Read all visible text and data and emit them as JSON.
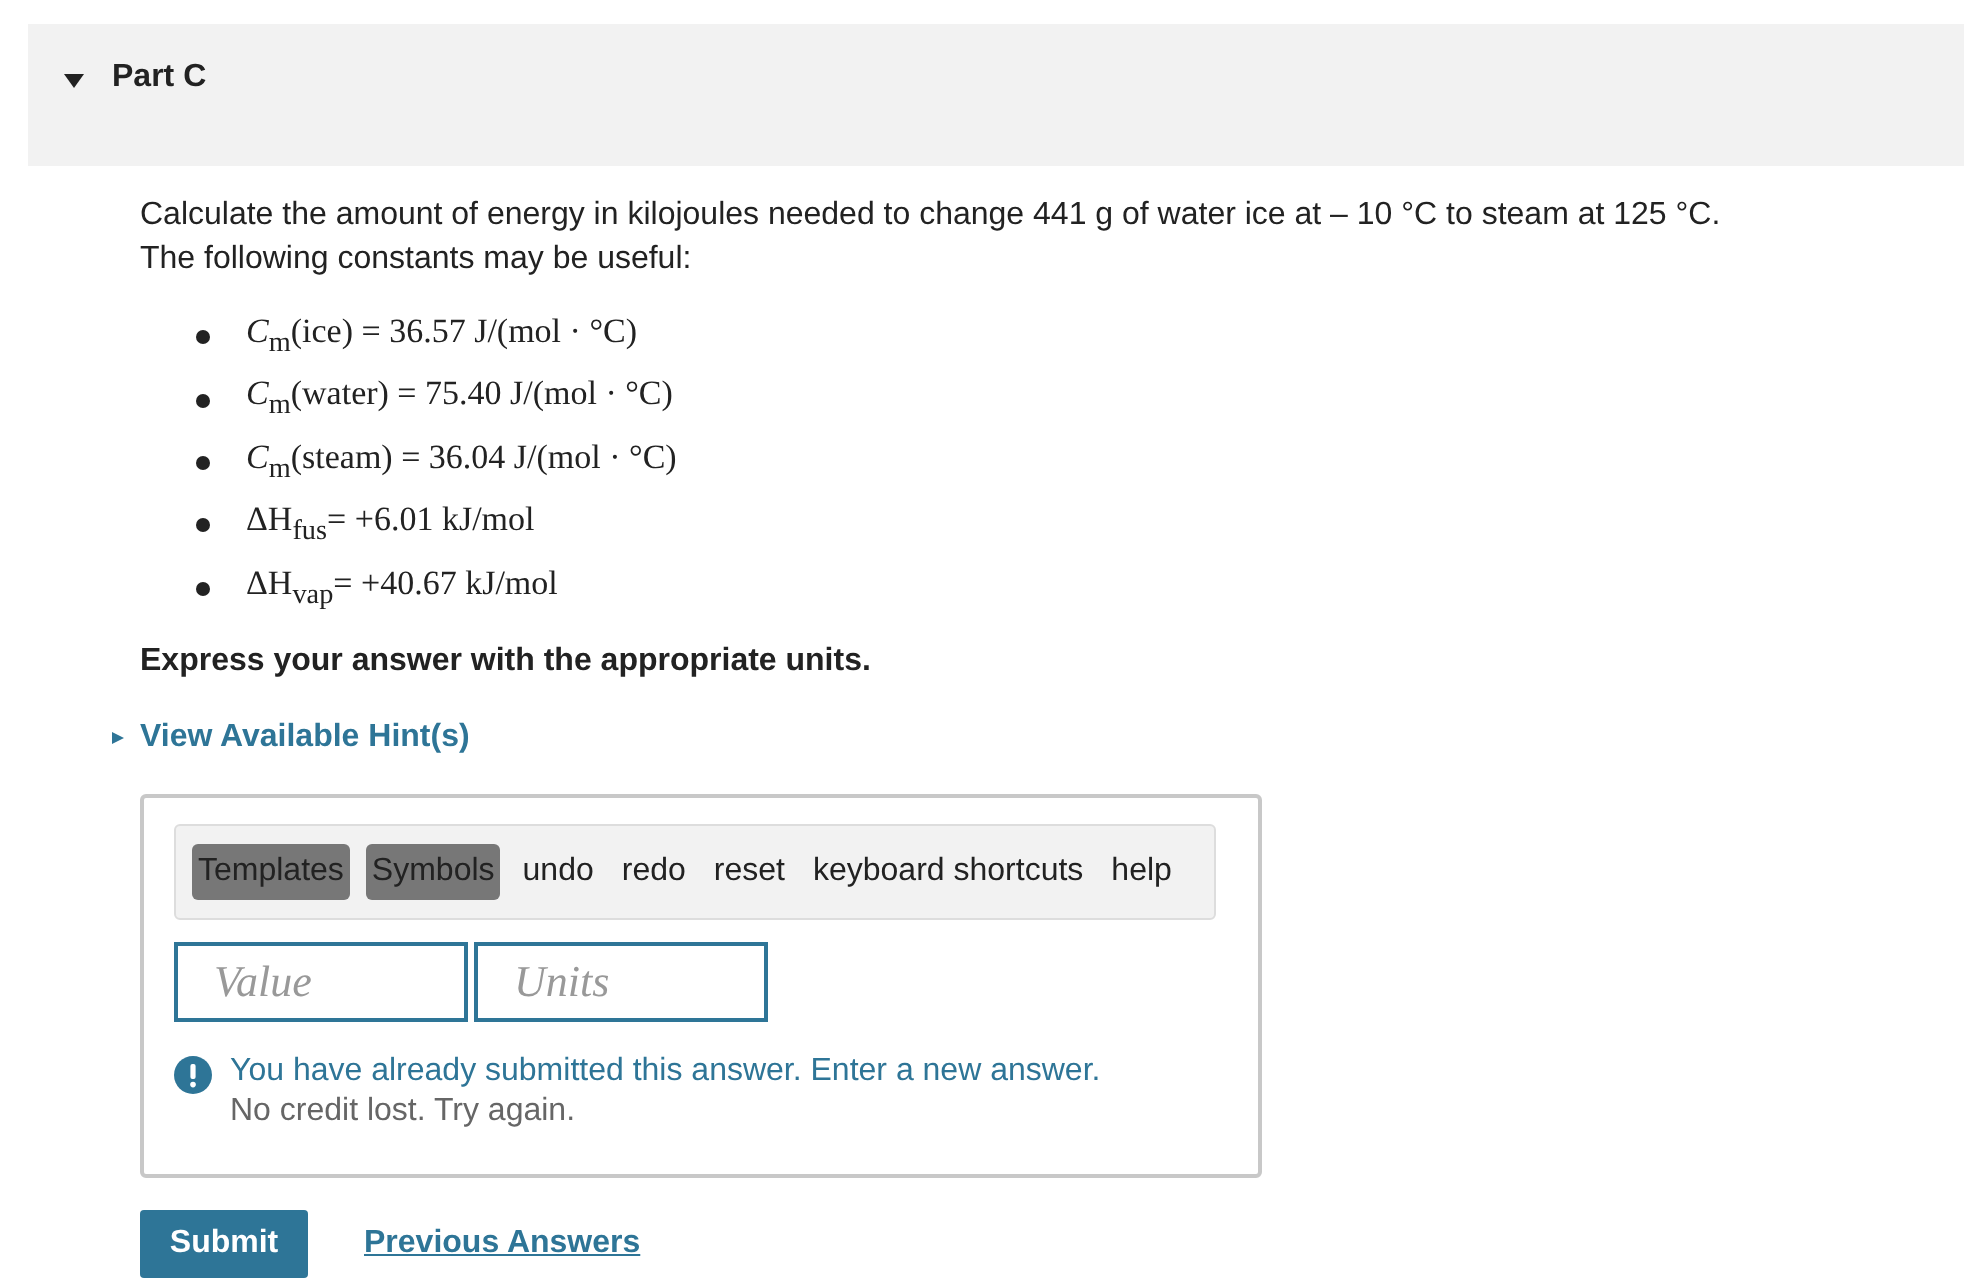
{
  "part": {
    "title": "Part C",
    "expanded": true
  },
  "question": [
    "Calculate the amount of energy in kilojoules needed to change 441 g of water ice at – 10 °C to steam at 125 °C.",
    "The following constants may be useful:"
  ],
  "constants": [
    "*C*$_{m}$(ice) = 36.57 J/(mol · °C)",
    "*C*$_{m}$(water) = 75.40 J/(mol · °C)",
    "*C*$_{m}$(steam) = 36.04 J/(mol · °C)",
    "ΔH$_{fus}$= +6.01 kJ/mol",
    "ΔH$_{vap}$= +40.67 kJ/mol"
  ],
  "instruction": "Express your answer with the appropriate units.",
  "hint": {
    "label": "View Available Hint(s)",
    "expanded": false
  },
  "toolbar": [
    {
      "label": "Templates",
      "kind": "menu"
    },
    {
      "label": "Symbols",
      "kind": "menu"
    },
    {
      "label": "undo",
      "kind": "plain"
    },
    {
      "label": "redo",
      "kind": "plain"
    },
    {
      "label": "reset",
      "kind": "plain"
    },
    {
      "label": "keyboard shortcuts",
      "kind": "plain"
    },
    {
      "label": "help",
      "kind": "plain"
    }
  ],
  "fields": [
    {
      "placeholder": "Value"
    },
    {
      "placeholder": "Units"
    }
  ],
  "feedback": {
    "message": "You have already submitted this answer. Enter a new answer.",
    "note": "No credit lost. Try again."
  },
  "submit": "Submit",
  "previous": "Previous Answers"
}
